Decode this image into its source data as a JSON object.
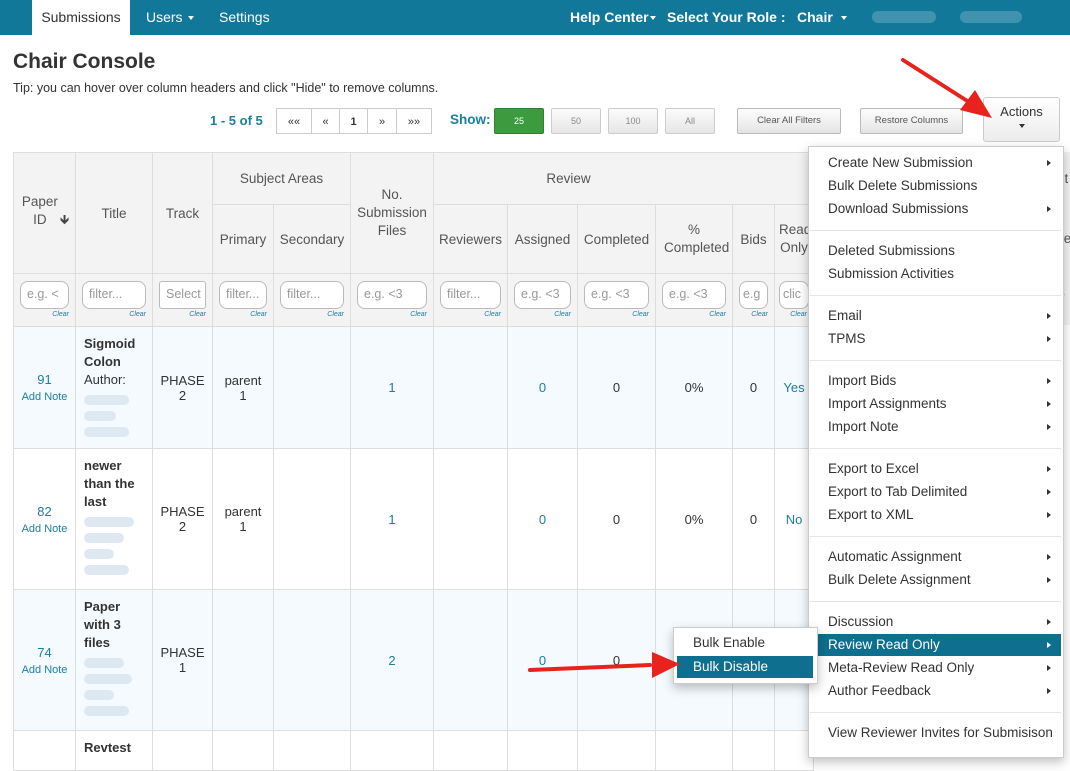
{
  "nav": {
    "tabs": [
      "Submissions",
      "Users",
      "Settings"
    ],
    "help_center": "Help Center",
    "role_label": "Select Your Role :",
    "role_value": "Chair"
  },
  "page": {
    "title": "Chair Console",
    "tip": "Tip: you can hover over column headers and click \"Hide\" to remove columns."
  },
  "pager": {
    "range": "1 - 5 of 5",
    "buttons": [
      "««",
      "«",
      "1",
      "»",
      "»»"
    ],
    "show_label": "Show:",
    "show_options": [
      "25",
      "50",
      "100",
      "All"
    ],
    "selected_show": "25"
  },
  "toolbar": {
    "clear_filters": "Clear All Filters",
    "restore_columns": "Restore Columns",
    "actions": "Actions"
  },
  "columns": {
    "paper_id": "Paper ID",
    "title": "Title",
    "track": "Track",
    "subject_areas": "Subject Areas",
    "primary": "Primary",
    "secondary": "Secondary",
    "no_files": "No. Submission Files",
    "review": "Review",
    "reviewers": "Reviewers",
    "assigned": "Assigned",
    "completed": "Completed",
    "pct_completed": "% Completed",
    "bids": "Bids",
    "read_only": "Read Only",
    "meta_partial": "et",
    "edge_partial": "te"
  },
  "filters": {
    "paper_id": "e.g. <",
    "title": "filter...",
    "track": "Select",
    "primary": "filter...",
    "secondary": "filter...",
    "no_files": "e.g. <3",
    "reviewers": "filter...",
    "assigned": "e.g. <3",
    "completed": "e.g. <3",
    "pct_completed": "e.g. <3",
    "bids": "e.g",
    "read_only": "clic",
    "edge": "3",
    "clear": "Clear"
  },
  "rows": [
    {
      "id": "91",
      "add_note": "Add Note",
      "title_lines": [
        "Sigmoid",
        "Colon"
      ],
      "author": "Author:",
      "track": [
        "PHASE",
        "2"
      ],
      "primary": [
        "parent",
        "1"
      ],
      "files": "1",
      "assigned": "0",
      "completed": "0",
      "pct": "0%",
      "bids": "0",
      "read_only": "Yes"
    },
    {
      "id": "82",
      "add_note": "Add Note",
      "title_lines": [
        "newer",
        "than the",
        "last"
      ],
      "author": "",
      "track": [
        "PHASE",
        "2"
      ],
      "primary": [
        "parent",
        "1"
      ],
      "files": "1",
      "assigned": "0",
      "completed": "0",
      "pct": "0%",
      "bids": "0",
      "read_only": "No"
    },
    {
      "id": "74",
      "add_note": "Add Note",
      "title_lines": [
        "Paper",
        "with 3",
        "files"
      ],
      "author": "",
      "track": [
        "PHASE",
        "1"
      ],
      "primary": [
        "",
        ""
      ],
      "files": "2",
      "assigned": "0",
      "completed": "0",
      "pct": "",
      "bids": "",
      "read_only": ""
    },
    {
      "id": "",
      "add_note": "",
      "title_lines": [
        "Revtest"
      ],
      "author": "",
      "track": [
        "",
        ""
      ],
      "primary": [
        "",
        ""
      ],
      "files": "",
      "assigned": "",
      "completed": "",
      "pct": "",
      "bids": "",
      "read_only": ""
    }
  ],
  "menu": {
    "groups": [
      [
        {
          "label": "Create New Submission",
          "sub": true
        },
        {
          "label": "Bulk Delete Submissions",
          "sub": false
        },
        {
          "label": "Download Submissions",
          "sub": true
        }
      ],
      [
        {
          "label": "Deleted Submissions",
          "sub": false
        },
        {
          "label": "Submission Activities",
          "sub": false
        }
      ],
      [
        {
          "label": "Email",
          "sub": true
        },
        {
          "label": "TPMS",
          "sub": true
        }
      ],
      [
        {
          "label": "Import Bids",
          "sub": true
        },
        {
          "label": "Import Assignments",
          "sub": true
        },
        {
          "label": "Import Note",
          "sub": true
        }
      ],
      [
        {
          "label": "Export to Excel",
          "sub": true
        },
        {
          "label": "Export to Tab Delimited",
          "sub": true
        },
        {
          "label": "Export to XML",
          "sub": true
        }
      ],
      [
        {
          "label": "Automatic Assignment",
          "sub": true
        },
        {
          "label": "Bulk Delete Assignment",
          "sub": true
        }
      ],
      [
        {
          "label": "Discussion",
          "sub": true
        },
        {
          "label": "Review Read Only",
          "sub": true,
          "active": true
        },
        {
          "label": "Meta-Review Read Only",
          "sub": true
        },
        {
          "label": "Author Feedback",
          "sub": true
        }
      ],
      [
        {
          "label": "View Reviewer Invites for Submisison",
          "sub": false
        }
      ]
    ],
    "submenu": [
      "Bulk Enable",
      "Bulk Disable"
    ]
  },
  "colors": {
    "nav_bg": "#12789a",
    "link": "#1a7fa0",
    "menu_active": "#0e6f8f",
    "show_active": "#3b9b3e",
    "annotation_arrow": "#e8231d"
  }
}
